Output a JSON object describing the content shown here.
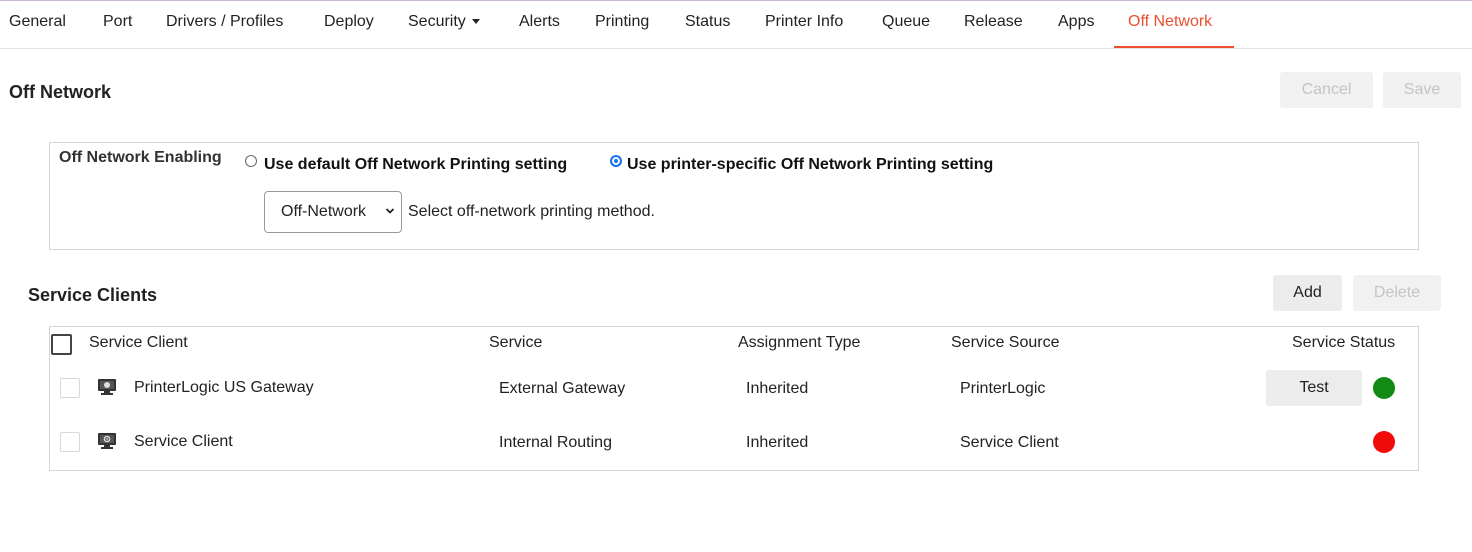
{
  "tabs": [
    {
      "label": "General"
    },
    {
      "label": "Port"
    },
    {
      "label": "Drivers / Profiles"
    },
    {
      "label": "Deploy"
    },
    {
      "label": "Security"
    },
    {
      "label": "Alerts"
    },
    {
      "label": "Printing"
    },
    {
      "label": "Status"
    },
    {
      "label": "Printer Info"
    },
    {
      "label": "Queue"
    },
    {
      "label": "Release"
    },
    {
      "label": "Apps"
    },
    {
      "label": "Off Network",
      "active": true
    }
  ],
  "page": {
    "title": "Off Network",
    "cancel_label": "Cancel",
    "save_label": "Save"
  },
  "off_network_enabling": {
    "label": "Off Network Enabling",
    "option_default": "Use default Off Network Printing setting",
    "option_specific": "Use printer-specific Off Network Printing setting",
    "selected_option": "specific",
    "method_value": "Off-Network",
    "method_help": "Select off-network printing method."
  },
  "service_clients": {
    "title": "Service Clients",
    "add_label": "Add",
    "delete_label": "Delete",
    "columns": [
      "Service Client",
      "Service",
      "Assignment Type",
      "Service Source",
      "Service Status"
    ],
    "rows": [
      {
        "name": "PrinterLogic US Gateway",
        "service": "External Gateway",
        "assignment": "Inherited",
        "source": "PrinterLogic",
        "test_label": "Test",
        "status_color": "#138a13"
      },
      {
        "name": "Service Client",
        "service": "Internal Routing",
        "assignment": "Inherited",
        "source": "Service Client",
        "status_color": "#f00a0a"
      }
    ]
  },
  "colors": {
    "accent": "#e8502f",
    "radio_selected": "#1a73e8"
  }
}
